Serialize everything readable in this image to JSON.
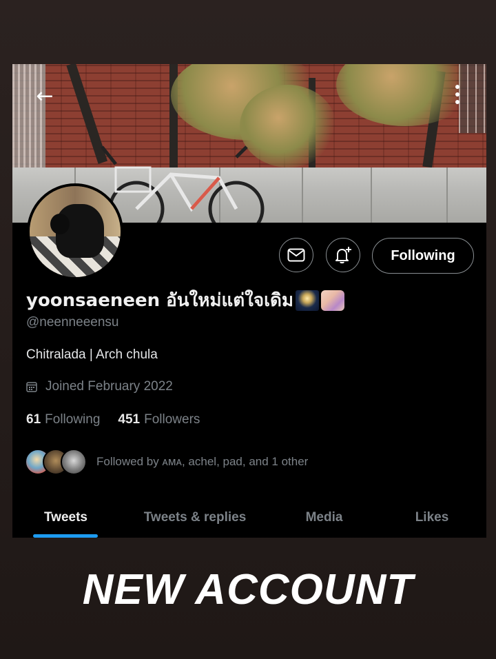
{
  "header": {
    "back_icon": "arrow-left-icon",
    "more_icon": "more-vertical-icon"
  },
  "profile": {
    "display_name": "yoonsaeneen อันใหม่แต่ใจเดิม",
    "emojis": [
      "fireworks-emoji",
      "nail-polish-emoji"
    ],
    "handle": "@neenneeensu",
    "bio": "Chitralada | Arch chula",
    "joined": "Joined February 2022",
    "following_count": "61",
    "following_label": "Following",
    "followers_count": "451",
    "followers_label": "Followers",
    "followed_by": "Followed by ᴀᴍᴀ, achel, pad, and 1 other"
  },
  "actions": {
    "message_icon": "mail-icon",
    "notify_icon": "bell-plus-icon",
    "follow_label": "Following"
  },
  "tabs": [
    {
      "label": "Tweets",
      "active": true
    },
    {
      "label": "Tweets & replies",
      "active": false
    },
    {
      "label": "Media",
      "active": false
    },
    {
      "label": "Likes",
      "active": false
    }
  ],
  "caption": "NEW ACCOUNT",
  "colors": {
    "accent": "#1d9bf0",
    "background": "#000000",
    "muted_text": "#7c8288"
  }
}
